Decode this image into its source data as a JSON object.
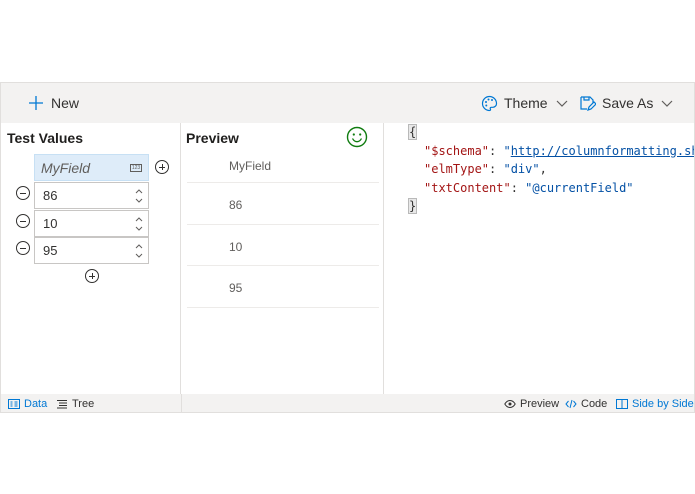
{
  "toolbar": {
    "new_label": "New",
    "theme_label": "Theme",
    "save_label": "Save As"
  },
  "test_values": {
    "title": "Test Values",
    "field_name": "MyField",
    "field_type_badge": "123",
    "values": [
      "86",
      "10",
      "95"
    ]
  },
  "preview": {
    "title": "Preview",
    "header": "MyField",
    "rows": [
      "86",
      "10",
      "95"
    ]
  },
  "code": {
    "open_brace": "{",
    "close_brace": "}",
    "lines": [
      {
        "key": "\"$schema\"",
        "sep": ": ",
        "value": "\"http://columnformatting.sharepointpnp.com/columnFormattingSchema.json\"",
        "trail": ","
      },
      {
        "key": "\"elmType\"",
        "sep": ": ",
        "value": "\"div\"",
        "trail": ","
      },
      {
        "key": "\"txtContent\"",
        "sep": ": ",
        "value": "\"@currentField\"",
        "trail": ""
      }
    ]
  },
  "footer": {
    "left": [
      {
        "label": "Data",
        "icon": "data-icon",
        "active": true
      },
      {
        "label": "Tree",
        "icon": "tree-icon",
        "active": false
      }
    ],
    "right": [
      {
        "label": "Preview",
        "icon": "eye-icon",
        "active": false
      },
      {
        "label": "Code",
        "icon": "code-icon",
        "active": false
      },
      {
        "label": "Side by Side",
        "icon": "side-by-side-icon",
        "active": true
      }
    ]
  },
  "colors": {
    "accent": "#0078d4",
    "smiley": "#107c10",
    "toolbar_bg": "#f3f2f1"
  }
}
